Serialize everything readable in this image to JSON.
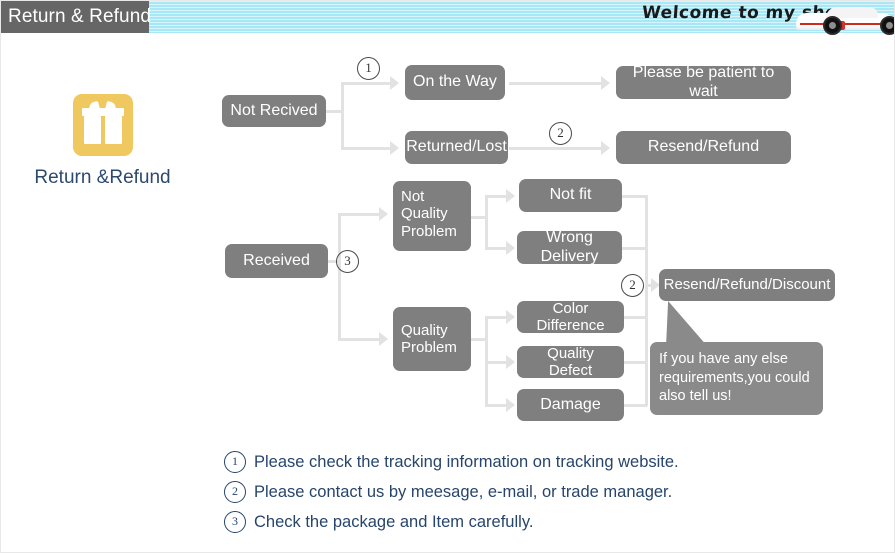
{
  "header": {
    "title": "Return & Refund",
    "welcome": "Welcome to my shop",
    "banner_color": "#a8e8f6",
    "title_bg": "#666666"
  },
  "brand": {
    "icon": "gift-icon",
    "icon_color": "#efc860",
    "label": "Return &Refund",
    "label_color": "#2c4a6e"
  },
  "flow": {
    "node_color": "#7f7f7f",
    "line_color": "#e2e2e2",
    "nodes": {
      "not_received": "Not Recived",
      "on_the_way": "On the Way",
      "returned_lost": "Returned/Lost",
      "please_wait": "Please be patient to wait",
      "resend_refund": "Resend/Refund",
      "received": "Received",
      "not_quality_problem": "Not\nQuality\nProblem",
      "not_quality_problem_l1": "Not",
      "not_quality_problem_l2": "Quality",
      "not_quality_problem_l3": "Problem",
      "not_fit": "Not fit",
      "wrong_delivery": "Wrong Delivery",
      "quality_problem_l1": "Quality",
      "quality_problem_l2": "Problem",
      "color_difference": "Color Difference",
      "quality_defect": "Quality Defect",
      "damage": "Damage",
      "resend_refund_discount": "Resend/Refund/Discount"
    },
    "markers": {
      "m1": "1",
      "m2": "2",
      "m3": "3",
      "m4": "2"
    }
  },
  "callout": {
    "text": "If you have any else requirements,you could also tell us!",
    "bg": "#8a8a8a"
  },
  "legend": {
    "color": "#27456b",
    "items": [
      {
        "num": "1",
        "text": "Please check the tracking information on tracking website."
      },
      {
        "num": "2",
        "text": "Please contact us by meesage, e-mail, or trade manager."
      },
      {
        "num": "3",
        "text": "Check the package and Item carefully."
      }
    ]
  }
}
